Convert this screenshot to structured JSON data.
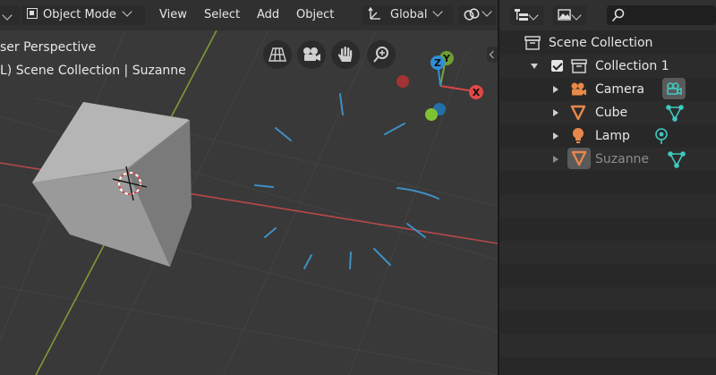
{
  "header": {
    "mode_label": "Object Mode",
    "menus": [
      "View",
      "Select",
      "Add",
      "Object"
    ],
    "orientation_label": "Global"
  },
  "viewport": {
    "view_label": "ser Perspective",
    "context_label": "L) Scene Collection | Suzanne",
    "gizmo": {
      "z_label": "Z",
      "y_label": "Y",
      "x_label": "X"
    },
    "nav_icons": [
      "grid-perspective-icon",
      "camera-view-icon",
      "hand-pan-icon",
      "zoom-icon"
    ]
  },
  "outliner": {
    "root_label": "Scene Collection",
    "collection_label": "Collection 1",
    "items": [
      {
        "name": "Camera",
        "icon": "camera-object-icon",
        "data_icon": "camera-data-icon"
      },
      {
        "name": "Cube",
        "icon": "mesh-object-icon",
        "data_icon": "mesh-data-icon"
      },
      {
        "name": "Lamp",
        "icon": "lamp-object-icon",
        "data_icon": "lamp-data-icon"
      },
      {
        "name": "Suzanne",
        "icon": "mesh-object-icon",
        "data_icon": "mesh-data-icon"
      }
    ]
  },
  "colors": {
    "accent_orange": "#e8884a",
    "data_teal": "#3ec9c0",
    "axis_red": "#c84a4a",
    "axis_green": "#7aa33a",
    "axis_blue": "#2f8fd6",
    "suzanne_wire": "#3f8fc4"
  }
}
